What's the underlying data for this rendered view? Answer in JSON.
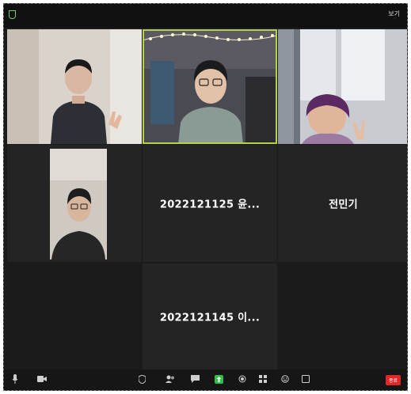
{
  "window": {
    "view_button_label": "보기"
  },
  "participants": [
    {
      "id": "p1",
      "name_tag": "",
      "has_video": true
    },
    {
      "id": "p2",
      "name_tag": "",
      "has_video": true,
      "active_speaker": true
    },
    {
      "id": "p3",
      "name_tag": "",
      "has_video": true
    },
    {
      "id": "p4",
      "name_tag": "",
      "has_video": true
    },
    {
      "id": "p5",
      "display_name": "2022121125 윤...",
      "has_video": false
    },
    {
      "id": "p6",
      "display_name": "전민기",
      "has_video": false
    },
    {
      "id": "p7",
      "display_name": "2022121145 이...",
      "has_video": false
    }
  ],
  "toolbar": {
    "leave_label": "종료",
    "icons": [
      "microphone-icon",
      "video-camera-icon",
      "security-icon",
      "participants-icon",
      "chat-icon",
      "share-screen-icon",
      "record-icon",
      "breakout-rooms-icon",
      "reactions-icon",
      "more-icon"
    ]
  },
  "colors": {
    "background": "#1b1b1b",
    "tile": "#242424",
    "active_speaker_border": "#b5d14a",
    "share_green": "#2fbf4a",
    "leave_red": "#e02828"
  }
}
